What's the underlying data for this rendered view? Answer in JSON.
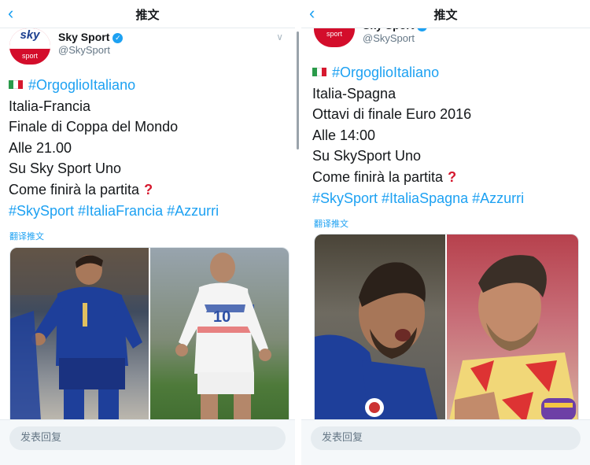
{
  "header_title": "推文",
  "reply_placeholder": "发表回复",
  "colors": {
    "twitter_blue": "#1da1f2",
    "sky_red": "#d30d2b",
    "italy_blue": "#1e3f9a"
  },
  "left": {
    "author": {
      "avatar_text_top": "sky",
      "avatar_text_bottom": "sport",
      "name": "Sky Sport",
      "handle": "@SkySport"
    },
    "lines": {
      "hashtag1": "#OrgoglioItaliano",
      "l2": "Italia-Francia",
      "l3": "Finale di Coppa del Mondo",
      "l4": "Alle 21.00",
      "l5": "Su Sky Sport Uno",
      "l6": "Come finirà la partita",
      "l7_tags": "#SkySport #ItaliaFrancia #Azzurri"
    },
    "translate_label": "翻译推文",
    "photo_jersey_number": "10"
  },
  "right": {
    "author": {
      "avatar_text_bottom": "sport",
      "name": "Sky Sport",
      "handle": "@SkySport"
    },
    "lines": {
      "hashtag1": "#OrgoglioItaliano",
      "l2": "Italia-Spagna",
      "l3": "Ottavi di finale Euro 2016",
      "l4": "Alle 14:00",
      "l5": "Su SkySport Uno",
      "l6": "Come finirà la partita",
      "l7_tags": "#SkySport #ItaliaSpagna #Azzurri"
    },
    "translate_label": "翻译推文"
  },
  "icons": [
    "back-icon",
    "verified-icon",
    "chevron-down-icon",
    "italy-flag-icon",
    "question-mark-icon"
  ]
}
